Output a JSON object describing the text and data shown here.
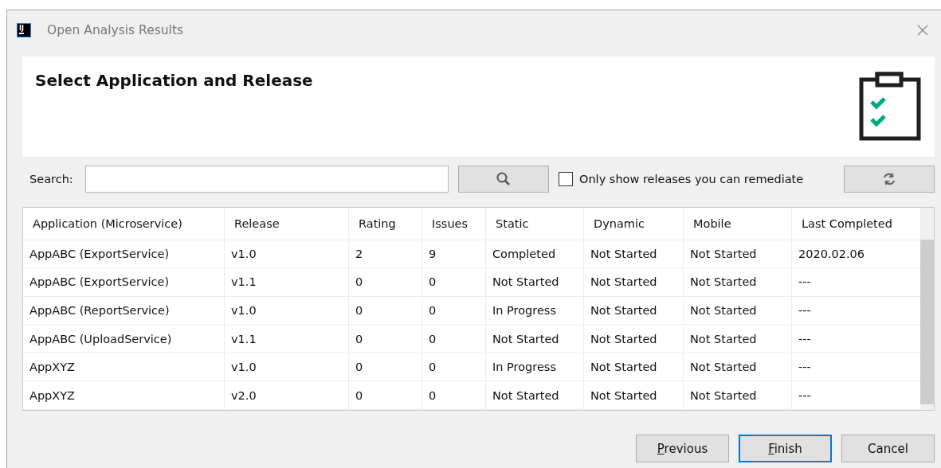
{
  "window": {
    "logo": "IJ",
    "title": "Open Analysis Results"
  },
  "header": {
    "title": "Select Application and Release"
  },
  "search": {
    "label": "Search:"
  },
  "filter": {
    "label": "Only show releases you can remediate",
    "checked": false
  },
  "table": {
    "columns": [
      "Application (Microservice)",
      "Release",
      "Rating",
      "Issues",
      "Static",
      "Dynamic",
      "Mobile",
      "Last Completed"
    ],
    "rows": [
      {
        "cells": [
          "AppABC (ExportService)",
          "v1.0",
          "2",
          "9",
          "Completed",
          "Not Started",
          "Not Started",
          "2020.02.06"
        ],
        "selected": false
      },
      {
        "cells": [
          "AppABC (ExportService)",
          "v1.1",
          "0",
          "0",
          "Not Started",
          "Not Started",
          "Not Started",
          "---"
        ],
        "selected": false
      },
      {
        "cells": [
          "AppABC (ReportService)",
          "v1.0",
          "0",
          "0",
          "In Progress",
          "Not Started",
          "Not Started",
          "---"
        ],
        "selected": false
      },
      {
        "cells": [
          "AppABC (UploadService)",
          "v1.1",
          "0",
          "0",
          "Not Started",
          "Not Started",
          "Not Started",
          "---"
        ],
        "selected": false
      },
      {
        "cells": [
          "AppXYZ",
          "v1.0",
          "0",
          "0",
          "In Progress",
          "Not Started",
          "Not Started",
          "---"
        ],
        "selected": false
      },
      {
        "cells": [
          "AppXYZ",
          "v2.0",
          "0",
          "0",
          "Not Started",
          "Not Started",
          "Not Started",
          "---"
        ],
        "selected": false
      }
    ]
  },
  "buttons": [
    {
      "label": "Previous",
      "underline_first": true,
      "default": false
    },
    {
      "label": "Finish",
      "underline_first": true,
      "default": true
    },
    {
      "label": "Cancel",
      "underline_first": false,
      "default": false
    }
  ]
}
